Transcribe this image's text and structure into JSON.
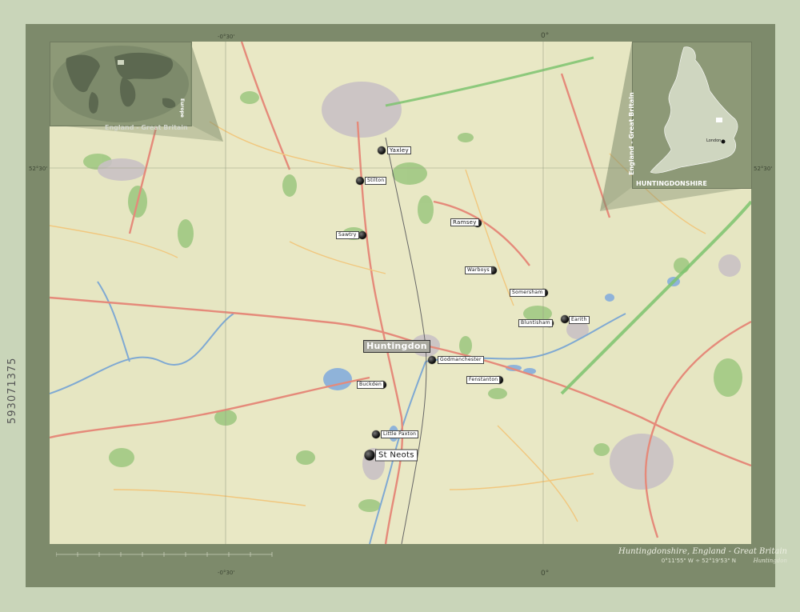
{
  "map": {
    "region": "Huntingdonshire",
    "country_inset_title": "England - Great Britain",
    "world_inset_title": "England - Great Britain",
    "world_inset_side_label": "Europe",
    "england_inset_side_label": "England - Great Britain",
    "england_inset_region_label": "HUNTINGDONSHIRE",
    "london_label": "London",
    "footer_title": "Huntingdonshire, England - Great Britain",
    "footer_coords": "0°11'55\" W ÷ 52°19'53\" N",
    "footer_capital": "Huntingdon",
    "watermark": "593071375",
    "coords": {
      "top_left": "-0°30'",
      "top_mid": "0°",
      "left_mid": "52°30'",
      "right_mid": "52°30'",
      "bottom_left": "-0°30'",
      "bottom_mid": "0°"
    },
    "places": [
      {
        "name": "Yaxley",
        "size": "mid"
      },
      {
        "name": "Stilton",
        "size": "small"
      },
      {
        "name": "Sawtry",
        "size": "small"
      },
      {
        "name": "Ramsey",
        "size": "small"
      },
      {
        "name": "Warboys",
        "size": "small"
      },
      {
        "name": "Somersham",
        "size": "small"
      },
      {
        "name": "Bluntisham",
        "size": "small"
      },
      {
        "name": "Earith",
        "size": "small"
      },
      {
        "name": "Huntingdon",
        "size": "capital"
      },
      {
        "name": "Godmanchester",
        "size": "small"
      },
      {
        "name": "Fenstanton",
        "size": "small"
      },
      {
        "name": "Buckden",
        "size": "small"
      },
      {
        "name": "Little Paxton",
        "size": "small"
      },
      {
        "name": "St Neots",
        "size": "large"
      }
    ],
    "colors": {
      "frame": "#7d8a6b",
      "map_background": "#e3e3bd",
      "water": "#8fb3d9",
      "roads": "#e58a7a",
      "green": "#8dc27e"
    }
  }
}
